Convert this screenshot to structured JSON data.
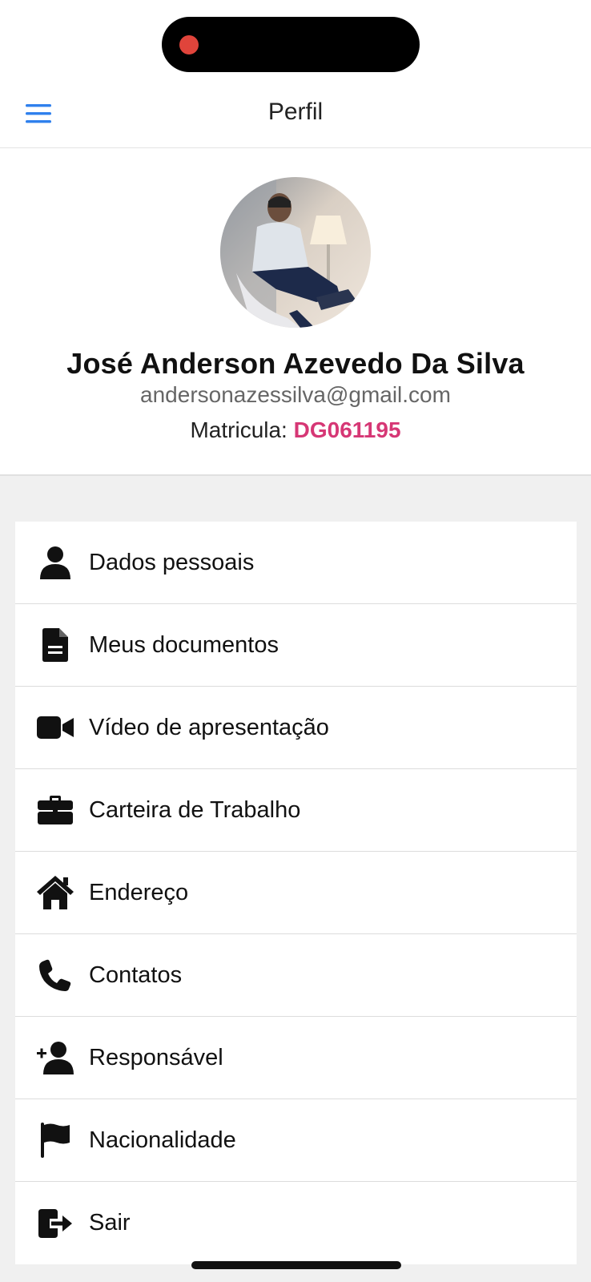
{
  "header": {
    "title": "Perfil",
    "menu_icon": "hamburger-menu-icon",
    "accent_color": "#2f80ed"
  },
  "status": {
    "recording_color": "#e0443b"
  },
  "profile": {
    "name": "José Anderson Azevedo Da Silva",
    "email": "andersonazessilva@gmail.com",
    "matricula_label": "Matricula:",
    "matricula_value": "DG061195",
    "matricula_color": "#d63775"
  },
  "menu": [
    {
      "label": "Dados pessoais",
      "icon": "user-icon"
    },
    {
      "label": "Meus documentos",
      "icon": "document-icon"
    },
    {
      "label": "Vídeo de apresentação",
      "icon": "video-camera-icon"
    },
    {
      "label": "Carteira de Trabalho",
      "icon": "briefcase-icon"
    },
    {
      "label": "Endereço",
      "icon": "home-icon"
    },
    {
      "label": "Contatos",
      "icon": "phone-icon"
    },
    {
      "label": "Responsável",
      "icon": "add-user-icon"
    },
    {
      "label": "Nacionalidade",
      "icon": "flag-icon"
    },
    {
      "label": "Sair",
      "icon": "logout-icon"
    }
  ]
}
